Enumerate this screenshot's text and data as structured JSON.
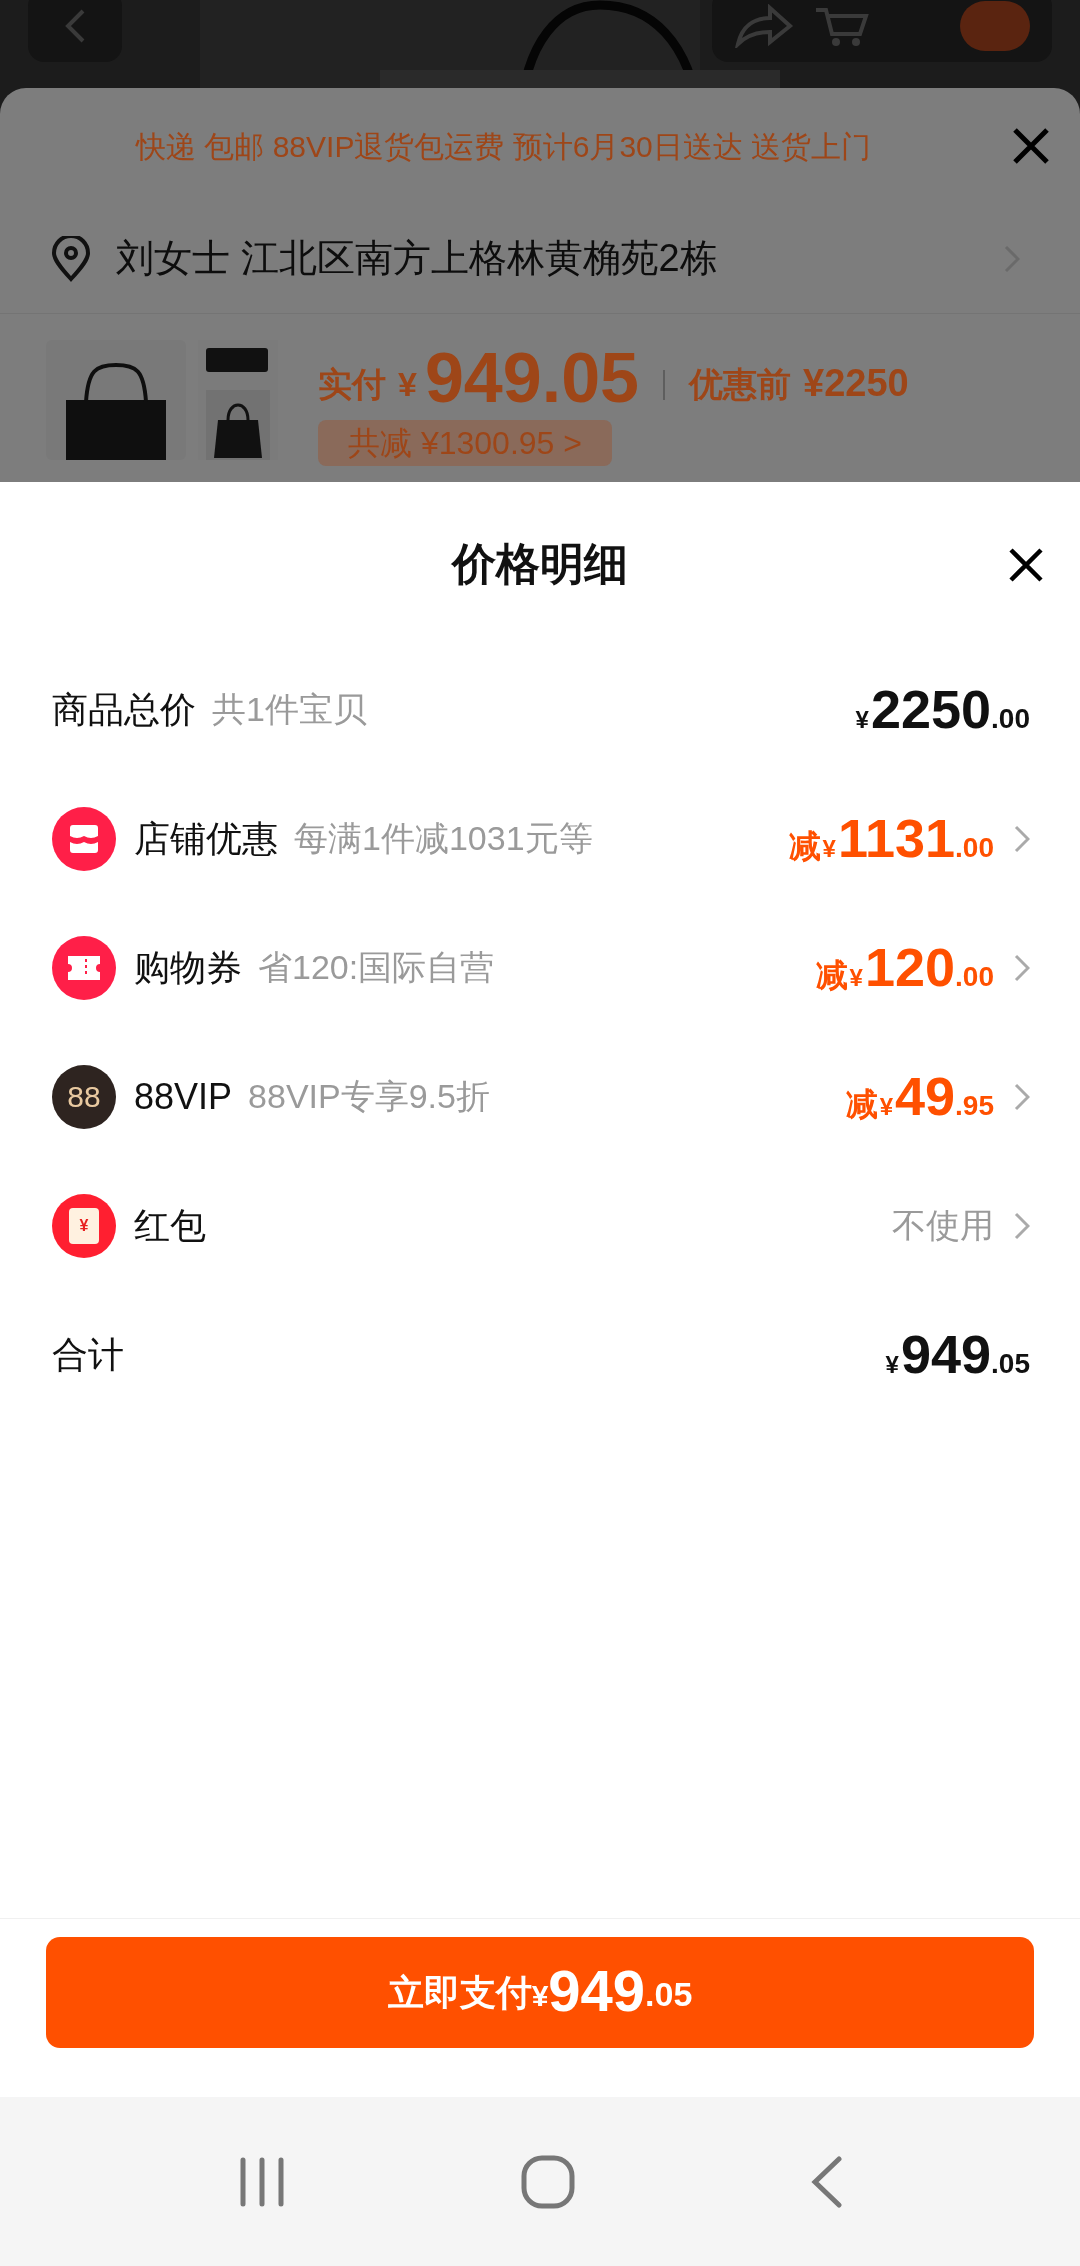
{
  "behind_page": {
    "shipping": "快递 包邮 88VIP退货包运费 预计6月30日送达 送货上门",
    "address": "刘女士 江北区南方上格林黄桷苑2栋",
    "paid_label": "实付",
    "paid_currency": "¥",
    "paid_amount": "949.05",
    "original_label": "优惠前",
    "original_price": "¥2250",
    "saving_chip": "共减 ¥1300.95 >"
  },
  "sheet": {
    "title": "价格明细",
    "rows": [
      {
        "kind": "total",
        "label": "商品总价",
        "note": "共1件宝贝",
        "currency": "¥",
        "integer": "2250",
        "decimal": ".00"
      },
      {
        "kind": "discount",
        "label": "店铺优惠",
        "note": "每满1件减1031元等",
        "prefix": "减",
        "currency": "¥",
        "integer": "1131",
        "decimal": ".00"
      },
      {
        "kind": "discount",
        "label": "购物券",
        "note": "省120:国际自营",
        "prefix": "减",
        "currency": "¥",
        "integer": "120",
        "decimal": ".00"
      },
      {
        "kind": "discount",
        "badge_text": "88",
        "label": "88VIP",
        "note": "88VIP专享9.5折",
        "prefix": "减",
        "currency": "¥",
        "integer": "49",
        "decimal": ".95"
      },
      {
        "kind": "option",
        "badge_text": "¥",
        "label": "红包",
        "value": "不使用"
      },
      {
        "kind": "total",
        "label": "合计",
        "currency": "¥",
        "integer": "949",
        "decimal": ".05"
      }
    ],
    "pay_button": {
      "label": "立即支付",
      "currency": "¥",
      "integer": "949",
      "decimal": ".05"
    }
  }
}
